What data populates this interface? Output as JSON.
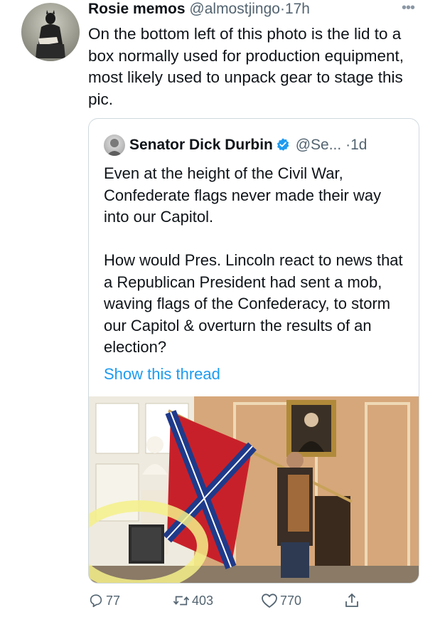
{
  "tweet": {
    "author_name": "Rosie memos",
    "handle": "@almostjingo",
    "separator": "·",
    "time": "17h",
    "more_icon": "more-icon",
    "text": "On the bottom left of this photo is the lid to a box normally used for production equipment, most likely used to unpack gear to stage this pic."
  },
  "quote": {
    "author_name": "Senator Dick Durbin",
    "handle": "@Se...",
    "separator": "·",
    "time": "1d",
    "verified_icon": "verified-badge-icon",
    "paragraphs": [
      "Even at the height of the Civil War, Confederate flags never made their way into our Capitol.",
      "How would Pres. Lincoln react to news that a Republican President had sent a mob, waving flags of the Confederacy, to storm our Capitol & overturn the results of an election?"
    ],
    "show_thread": "Show this thread",
    "media": "photo"
  },
  "actions": {
    "reply_count": "77",
    "retweet_count": "403",
    "like_count": "770",
    "share_icon": "share-icon"
  },
  "colors": {
    "link": "#1d9bf0",
    "secondary_text": "#536471",
    "border": "#cfd9de",
    "highlight": "#f5f08a"
  }
}
